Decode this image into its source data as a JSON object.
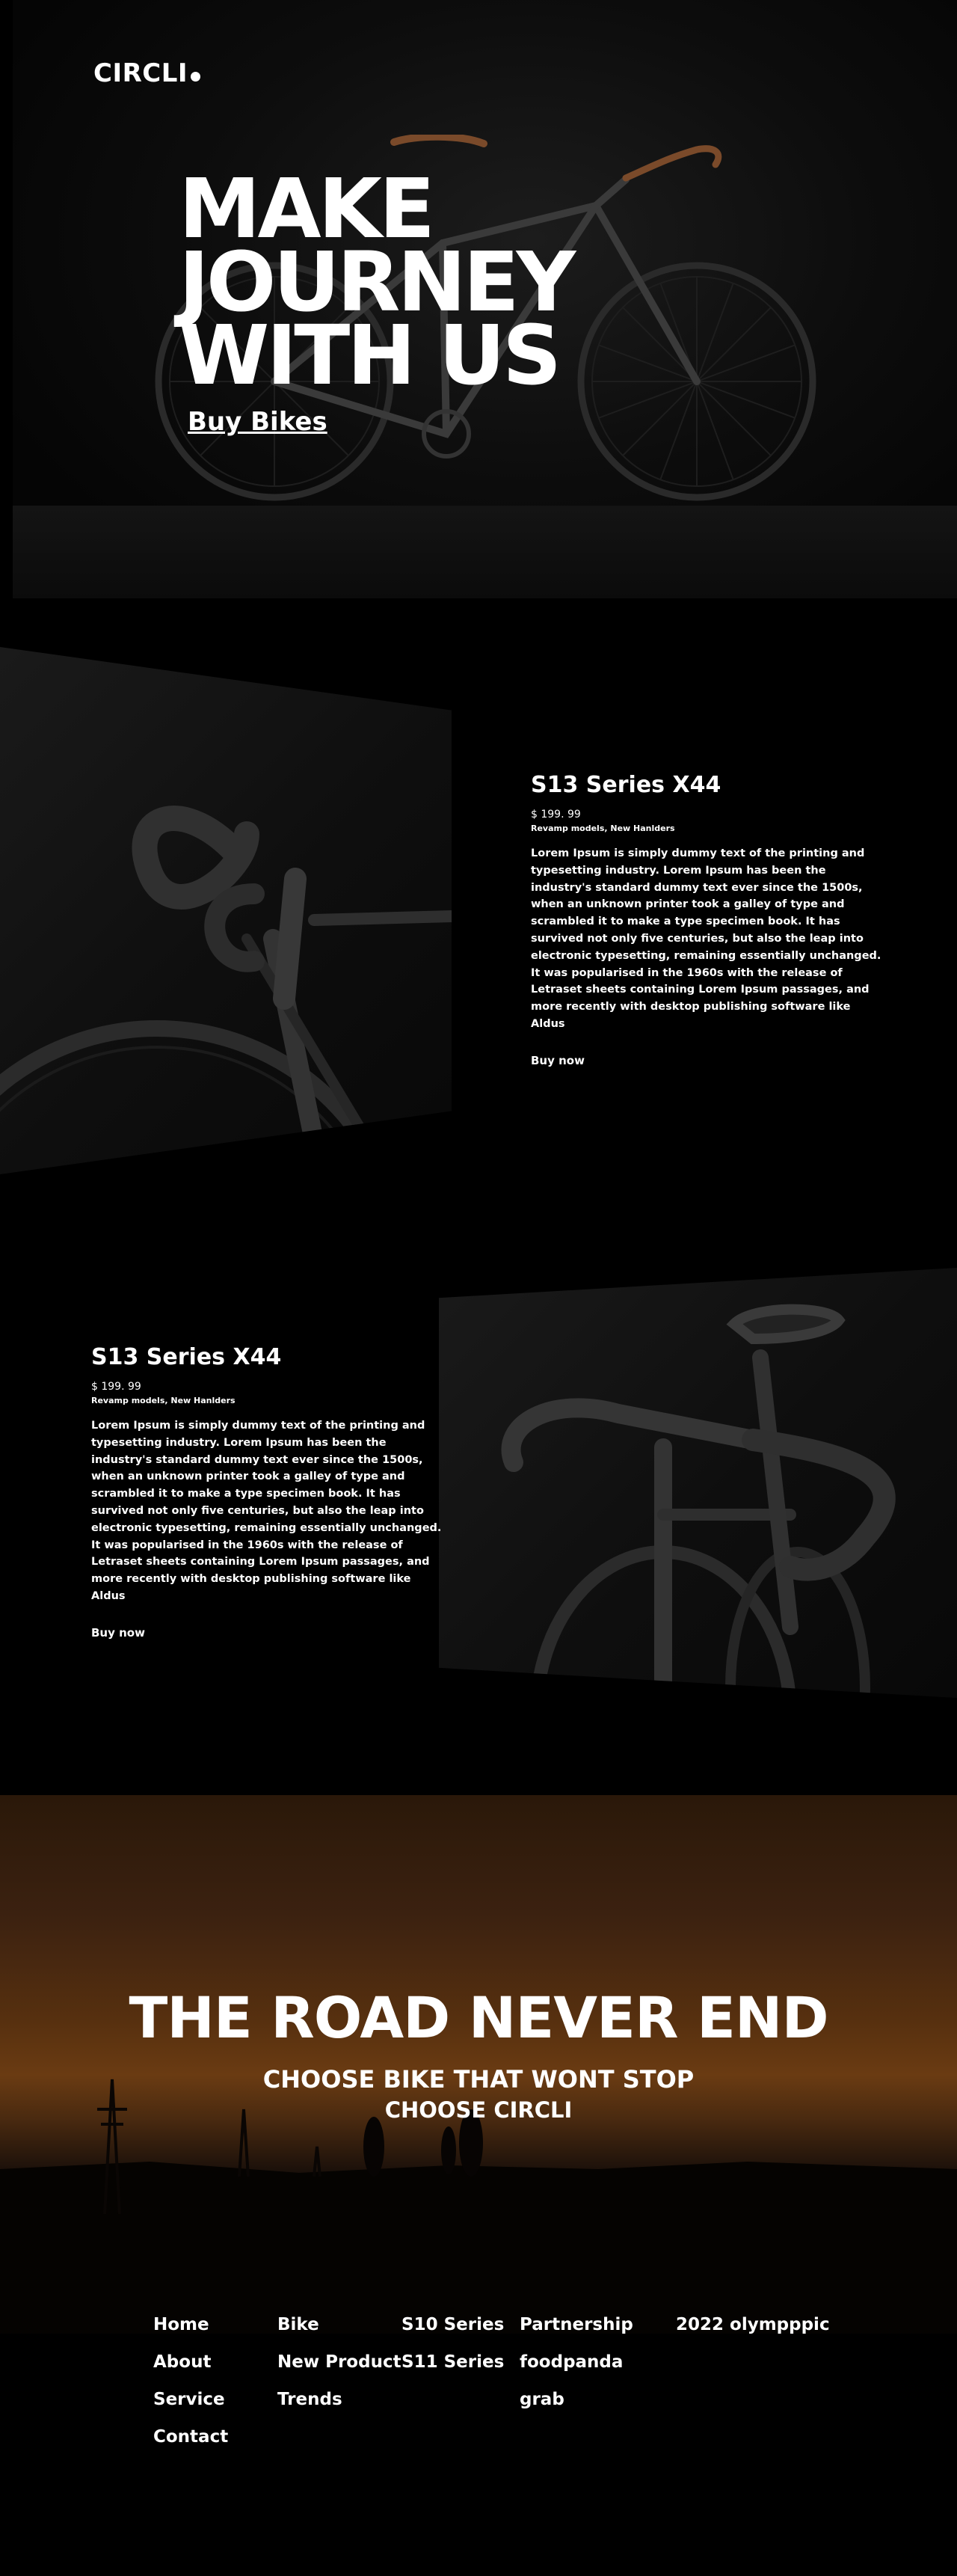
{
  "brand": {
    "logo": "CIRCLI"
  },
  "hero": {
    "title_lines": [
      "MAKE",
      "JOURNEY",
      "WITH US"
    ],
    "cta": "Buy Bikes"
  },
  "products": [
    {
      "name": "S13 Series X44",
      "price": "$ 199. 99",
      "subtitle": "Revamp models, New Hanlders",
      "description": "Lorem Ipsum is simply dummy text of the printing and typesetting industry. Lorem Ipsum has been the industry's standard dummy text ever since the 1500s, when an unknown printer took a galley of type and scrambled it to make a type specimen book. It has survived not only five centuries, but also the leap into electronic typesetting, remaining essentially unchanged. It was popularised in the 1960s with the release of Letraset sheets containing Lorem Ipsum passages, and more recently with desktop publishing software like Aldus",
      "cta": "Buy now"
    },
    {
      "name": "S13 Series X44",
      "price": "$ 199. 99",
      "subtitle": "Revamp models, New Hanlders",
      "description": "Lorem Ipsum is simply dummy text of the printing and typesetting industry. Lorem Ipsum has been the industry's standard dummy text ever since the 1500s, when an unknown printer took a galley of type and scrambled it to make a type specimen book. It has survived not only five centuries, but also the leap into electronic typesetting, remaining essentially unchanged. It was popularised in the 1960s with the release of Letraset sheets containing Lorem Ipsum passages, and more recently with desktop publishing software like Aldus",
      "cta": "Buy now"
    }
  ],
  "banner": {
    "title": "THE ROAD NEVER END",
    "line2": "CHOOSE BIKE THAT WONT STOP",
    "line3": "CHOOSE CIRCLI"
  },
  "footer": {
    "columns": [
      [
        "Home",
        "About",
        "Service",
        "Contact"
      ],
      [
        "Bike",
        "New Product",
        "Trends"
      ],
      [
        "S10 Series",
        "S11 Series"
      ],
      [
        "Partnership",
        "foodpanda",
        "grab"
      ],
      [
        "2022 olympppic"
      ]
    ]
  },
  "colors": {
    "background": "#000000",
    "text": "#ffffff",
    "sunset": "#6a3b12",
    "saddle": "#7a4a2a"
  }
}
